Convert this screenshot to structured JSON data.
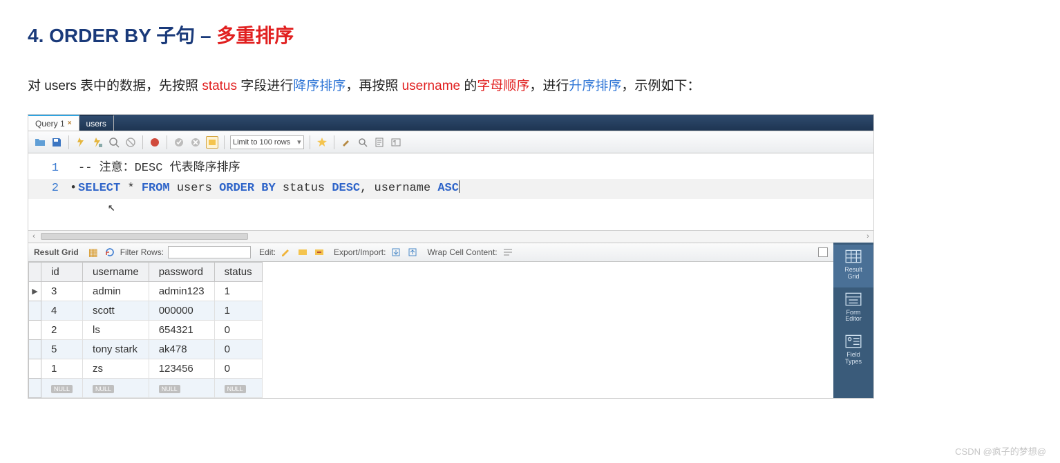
{
  "heading": {
    "prefix": "4. ORDER BY 子句 – ",
    "emph": "多重排序"
  },
  "desc": {
    "t1": "对 users 表中的数据，先按照 ",
    "red1": "status",
    "t2": " 字段进行",
    "blue1": "降序排序",
    "t3": "，再按照 ",
    "red2": "username",
    "t4": " 的",
    "red3": "字母顺序",
    "t5": "，进行",
    "blue2": "升序排序",
    "t6": "，示例如下："
  },
  "tabs": {
    "active": "Query 1",
    "inactive": "users"
  },
  "toolbar": {
    "limit_label": "Limit to 100 rows"
  },
  "editor": {
    "line1_no": "1",
    "line2_no": "2",
    "bullet": "•",
    "line1_comment": "-- 注意：DESC 代表降序排序",
    "line2": {
      "k1": "SELECT",
      "s1": " * ",
      "k2": "FROM",
      "s2": " users ",
      "k3": "ORDER BY",
      "s3": " status ",
      "k4": "DESC",
      "s4": ", username ",
      "k5": "ASC"
    }
  },
  "result_toolbar": {
    "label": "Result Grid",
    "filter_label": "Filter Rows:",
    "edit_label": "Edit:",
    "export_label": "Export/Import:",
    "wrap_label": "Wrap Cell Content:"
  },
  "result": {
    "columns": [
      "id",
      "username",
      "password",
      "status"
    ],
    "rows": [
      [
        "3",
        "admin",
        "admin123",
        "1"
      ],
      [
        "4",
        "scott",
        "000000",
        "1"
      ],
      [
        "2",
        "ls",
        "654321",
        "0"
      ],
      [
        "5",
        "tony stark",
        "ak478",
        "0"
      ],
      [
        "1",
        "zs",
        "123456",
        "0"
      ]
    ],
    "null_label": "NULL"
  },
  "side_labels": {
    "grid": "Result\nGrid",
    "form": "Form\nEditor",
    "field": "Field\nTypes"
  },
  "watermark": "CSDN @疯子的梦想@"
}
